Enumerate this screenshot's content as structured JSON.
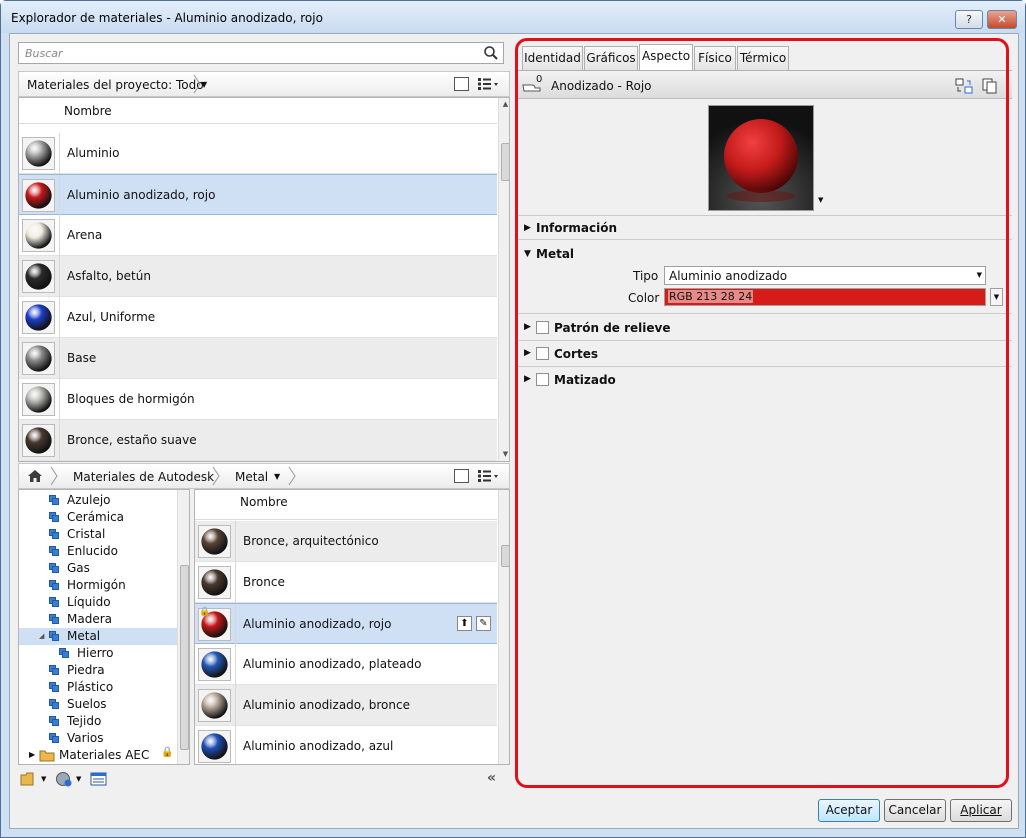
{
  "window": {
    "title": "Explorador de materiales - Aluminio anodizado, rojo",
    "help_label": "?",
    "close_label": "✕"
  },
  "search": {
    "placeholder": "Buscar"
  },
  "project": {
    "crumb": "Materiales del proyecto: Todo",
    "column_header": "Nombre",
    "items": [
      {
        "label": "Aluminio",
        "swatch": "#a9a9a9"
      },
      {
        "label": "Aluminio anodizado, rojo",
        "swatch": "#c7191b"
      },
      {
        "label": "Arena",
        "swatch": "#efece0"
      },
      {
        "label": "Asfalto, betún",
        "swatch": "#2b2b2b"
      },
      {
        "label": "Azul, Uniforme",
        "swatch": "#1d3ec9"
      },
      {
        "label": "Base",
        "swatch": "#8a8a8a"
      },
      {
        "label": "Bloques de hormigón",
        "swatch": "#b6b6b0"
      },
      {
        "label": "Bronce, estaño suave",
        "swatch": "#4a3a30"
      }
    ]
  },
  "library": {
    "crumb_root": "Materiales de Autodesk",
    "crumb_sub": "Metal",
    "tree": [
      {
        "label": "Azulejo",
        "level": 1
      },
      {
        "label": "Cerámica",
        "level": 1
      },
      {
        "label": "Cristal",
        "level": 1
      },
      {
        "label": "Enlucido",
        "level": 1
      },
      {
        "label": "Gas",
        "level": 1
      },
      {
        "label": "Hormigón",
        "level": 1
      },
      {
        "label": "Líquido",
        "level": 1
      },
      {
        "label": "Madera",
        "level": 1
      },
      {
        "label": "Metal",
        "level": 1,
        "selected": true
      },
      {
        "label": "Hierro",
        "level": 2
      },
      {
        "label": "Piedra",
        "level": 1
      },
      {
        "label": "Plástico",
        "level": 1
      },
      {
        "label": "Suelos",
        "level": 1
      },
      {
        "label": "Tejido",
        "level": 1
      },
      {
        "label": "Varios",
        "level": 1
      },
      {
        "label": "Materiales AEC",
        "level": 0
      }
    ],
    "column_header": "Nombre",
    "items": [
      {
        "label": "Bronce, arquitectónico",
        "swatch": "#5a4538"
      },
      {
        "label": "Bronce",
        "swatch": "#4a3a30"
      },
      {
        "label": "Aluminio anodizado, rojo",
        "swatch": "#c7191b"
      },
      {
        "label": "Aluminio anodizado, plateado",
        "swatch": "#2458b5"
      },
      {
        "label": "Aluminio anodizado, bronce",
        "swatch": "#b7a898"
      },
      {
        "label": "Aluminio anodizado, azul",
        "swatch": "#1f4fb8"
      }
    ]
  },
  "tabs": [
    "Identidad",
    "Gráficos",
    "Aspecto",
    "Físico",
    "Térmico"
  ],
  "asset": {
    "count": "0",
    "name": "Anodizado - Rojo"
  },
  "sections": {
    "info": "Información",
    "metal": "Metal",
    "tipo_label": "Tipo",
    "tipo_value": "Aluminio anodizado",
    "color_label": "Color",
    "color_value": "RGB 213 28 24",
    "color_hex": "#d51c18",
    "relief": "Patrón de relieve",
    "cuts": "Cortes",
    "tint": "Matizado"
  },
  "buttons": {
    "ok": "Aceptar",
    "cancel": "Cancelar",
    "apply": "Aplicar"
  }
}
